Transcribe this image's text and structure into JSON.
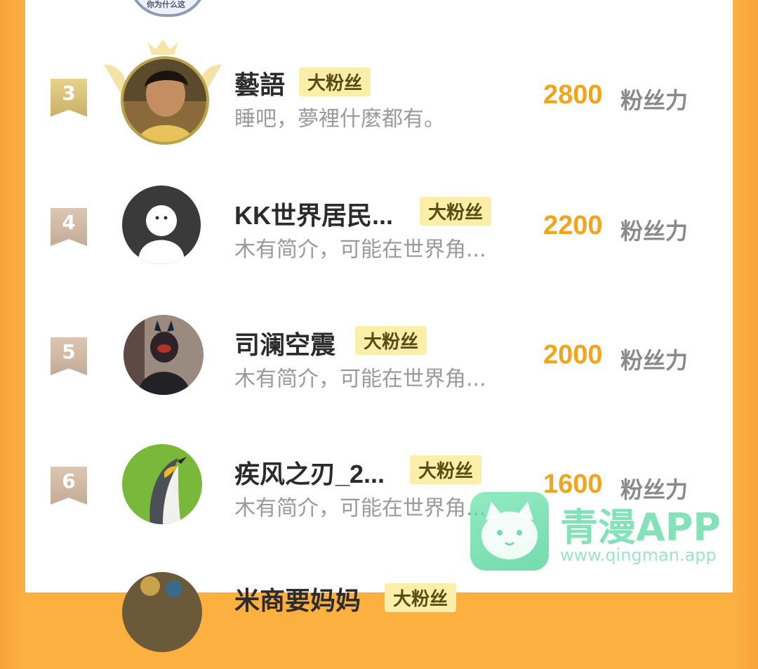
{
  "top_partial_avatar_caption": "你为什么这",
  "entries": [
    {
      "rank": "3",
      "name": "藝語",
      "badge": "大粉丝",
      "bio": "睡吧，夢裡什麼都有。",
      "score": "2800",
      "unit": "粉丝力"
    },
    {
      "rank": "4",
      "name": "KK世界居民...",
      "badge": "大粉丝",
      "bio": "木有简介，可能在世界角...",
      "score": "2200",
      "unit": "粉丝力"
    },
    {
      "rank": "5",
      "name": "司澜空震",
      "badge": "大粉丝",
      "bio": "木有简介，可能在世界角...",
      "score": "2000",
      "unit": "粉丝力"
    },
    {
      "rank": "6",
      "name": "疾风之刃_2...",
      "badge": "大粉丝",
      "bio": "木有简介，可能在世界角...",
      "score": "1600",
      "unit": "粉丝力"
    },
    {
      "rank": "",
      "name": "米商要妈妈",
      "badge": "大粉丝",
      "bio": "",
      "score": "",
      "unit": ""
    }
  ],
  "watermark": {
    "title": "青漫APP",
    "url": "www.qingman.app"
  },
  "colors": {
    "accent": "#f2a51a",
    "badge_bg": "#fbeea8",
    "side": "#fbb040",
    "watermark": "#66dba8"
  }
}
